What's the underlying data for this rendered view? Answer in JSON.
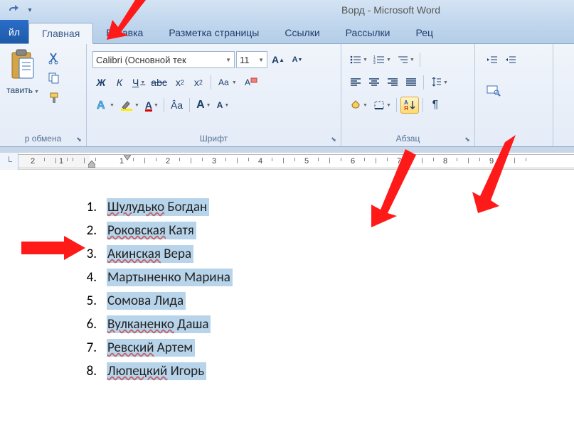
{
  "title": "Ворд - Microsoft Word",
  "tabs": {
    "file": "йл",
    "home": "Главная",
    "insert": "Вставка",
    "layout": "Разметка страницы",
    "refs": "Ссылки",
    "mail": "Рассылки",
    "review": "Рец"
  },
  "clipboard": {
    "paste": "тавить",
    "label": "р обмена"
  },
  "font": {
    "name": "Calibri (Основной тек",
    "size": "11",
    "label": "Шрифт"
  },
  "para": {
    "label": "Абзац"
  },
  "ruler": {
    "numbers": [
      "2",
      "1",
      "1",
      "2",
      "3",
      "4",
      "5",
      "6",
      "7",
      "8",
      "9"
    ]
  },
  "list": [
    {
      "n": "1.",
      "surname": "Шулудько",
      "rest": " Богдан",
      "wave": true
    },
    {
      "n": "2.",
      "surname": "Роковская",
      "rest": " Катя",
      "wave": true
    },
    {
      "n": "3.",
      "surname": "Акинская",
      "rest": " Вера",
      "wave": true
    },
    {
      "n": "4.",
      "surname": "Мартыненко",
      "rest": " Марина",
      "wave": false
    },
    {
      "n": "5.",
      "surname": "Сомова",
      "rest": " Лида",
      "wave": false
    },
    {
      "n": "6.",
      "surname": "Вулканенко",
      "rest": " Даша",
      "wave": true
    },
    {
      "n": "7.",
      "surname": "Ревский",
      "rest": " Артем",
      "wave": true
    },
    {
      "n": "8.",
      "surname": "Люпецкий",
      "rest": " Игорь",
      "wave": true
    }
  ]
}
